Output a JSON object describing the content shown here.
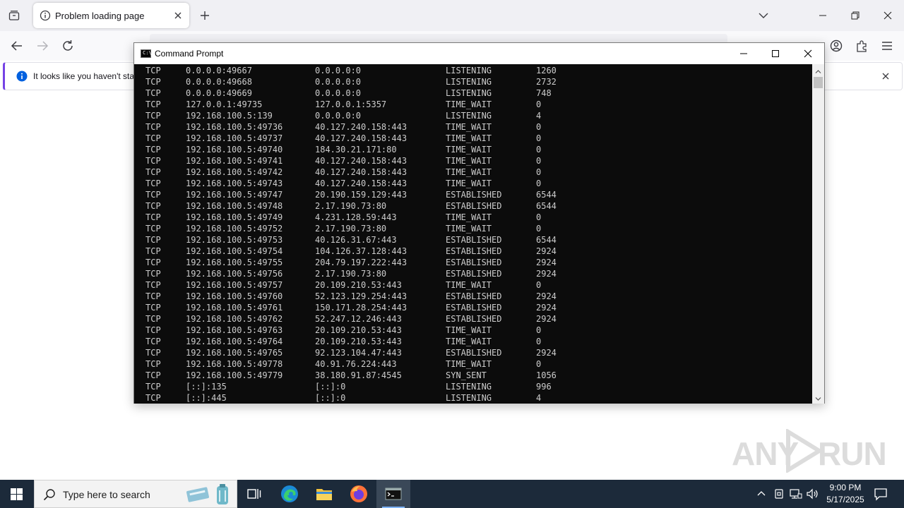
{
  "browser": {
    "tab": {
      "title": "Problem loading page"
    },
    "infobar": {
      "text": "It looks like you haven't star"
    }
  },
  "cmd": {
    "title": "Command Prompt",
    "rows": [
      [
        "TCP",
        "0.0.0.0:49667",
        "0.0.0.0:0",
        "LISTENING",
        "1260"
      ],
      [
        "TCP",
        "0.0.0.0:49668",
        "0.0.0.0:0",
        "LISTENING",
        "2732"
      ],
      [
        "TCP",
        "0.0.0.0:49669",
        "0.0.0.0:0",
        "LISTENING",
        "748"
      ],
      [
        "TCP",
        "127.0.0.1:49735",
        "127.0.0.1:5357",
        "TIME_WAIT",
        "0"
      ],
      [
        "TCP",
        "192.168.100.5:139",
        "0.0.0.0:0",
        "LISTENING",
        "4"
      ],
      [
        "TCP",
        "192.168.100.5:49736",
        "40.127.240.158:443",
        "TIME_WAIT",
        "0"
      ],
      [
        "TCP",
        "192.168.100.5:49737",
        "40.127.240.158:443",
        "TIME_WAIT",
        "0"
      ],
      [
        "TCP",
        "192.168.100.5:49740",
        "184.30.21.171:80",
        "TIME_WAIT",
        "0"
      ],
      [
        "TCP",
        "192.168.100.5:49741",
        "40.127.240.158:443",
        "TIME_WAIT",
        "0"
      ],
      [
        "TCP",
        "192.168.100.5:49742",
        "40.127.240.158:443",
        "TIME_WAIT",
        "0"
      ],
      [
        "TCP",
        "192.168.100.5:49743",
        "40.127.240.158:443",
        "TIME_WAIT",
        "0"
      ],
      [
        "TCP",
        "192.168.100.5:49747",
        "20.190.159.129:443",
        "ESTABLISHED",
        "6544"
      ],
      [
        "TCP",
        "192.168.100.5:49748",
        "2.17.190.73:80",
        "ESTABLISHED",
        "6544"
      ],
      [
        "TCP",
        "192.168.100.5:49749",
        "4.231.128.59:443",
        "TIME_WAIT",
        "0"
      ],
      [
        "TCP",
        "192.168.100.5:49752",
        "2.17.190.73:80",
        "TIME_WAIT",
        "0"
      ],
      [
        "TCP",
        "192.168.100.5:49753",
        "40.126.31.67:443",
        "ESTABLISHED",
        "6544"
      ],
      [
        "TCP",
        "192.168.100.5:49754",
        "104.126.37.128:443",
        "ESTABLISHED",
        "2924"
      ],
      [
        "TCP",
        "192.168.100.5:49755",
        "204.79.197.222:443",
        "ESTABLISHED",
        "2924"
      ],
      [
        "TCP",
        "192.168.100.5:49756",
        "2.17.190.73:80",
        "ESTABLISHED",
        "2924"
      ],
      [
        "TCP",
        "192.168.100.5:49757",
        "20.109.210.53:443",
        "TIME_WAIT",
        "0"
      ],
      [
        "TCP",
        "192.168.100.5:49760",
        "52.123.129.254:443",
        "ESTABLISHED",
        "2924"
      ],
      [
        "TCP",
        "192.168.100.5:49761",
        "150.171.28.254:443",
        "ESTABLISHED",
        "2924"
      ],
      [
        "TCP",
        "192.168.100.5:49762",
        "52.247.12.246:443",
        "ESTABLISHED",
        "2924"
      ],
      [
        "TCP",
        "192.168.100.5:49763",
        "20.109.210.53:443",
        "TIME_WAIT",
        "0"
      ],
      [
        "TCP",
        "192.168.100.5:49764",
        "20.109.210.53:443",
        "TIME_WAIT",
        "0"
      ],
      [
        "TCP",
        "192.168.100.5:49765",
        "92.123.104.47:443",
        "ESTABLISHED",
        "2924"
      ],
      [
        "TCP",
        "192.168.100.5:49778",
        "40.91.76.224:443",
        "TIME_WAIT",
        "0"
      ],
      [
        "TCP",
        "192.168.100.5:49779",
        "38.180.91.87:4545",
        "SYN_SENT",
        "1056"
      ],
      [
        "TCP",
        "[::]:135",
        "[::]:0",
        "LISTENING",
        "996"
      ],
      [
        "TCP",
        "[::]:445",
        "[::]:0",
        "LISTENING",
        "4"
      ]
    ]
  },
  "watermark": {
    "text1": "ANY",
    "text2": "RUN"
  },
  "taskbar": {
    "search_placeholder": "Type here to search",
    "time": "9:00 PM",
    "date": "5/17/2025"
  },
  "icons": {
    "tab": "info-circle-icon",
    "search": "magnifier-icon",
    "start": "windows-logo-icon"
  }
}
